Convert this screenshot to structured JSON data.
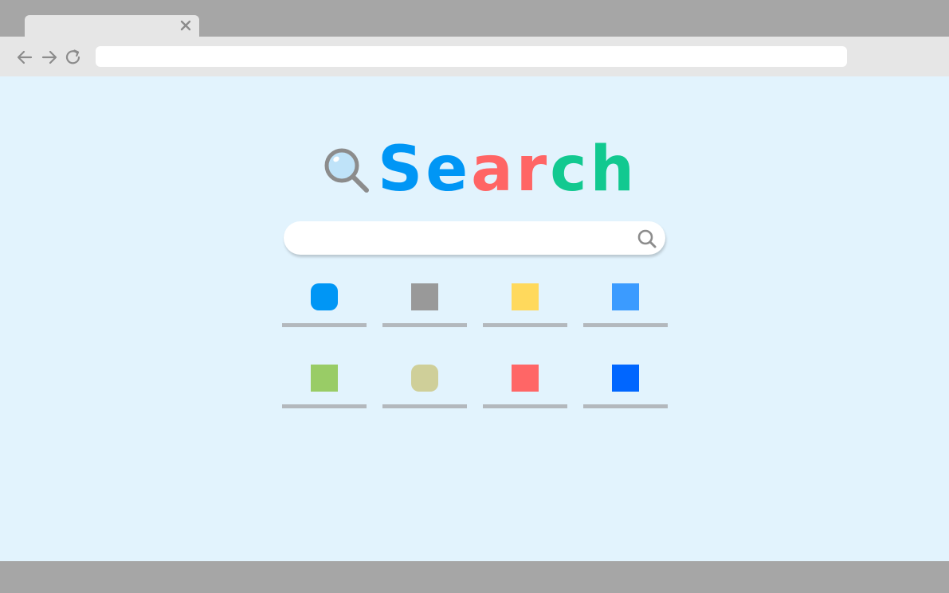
{
  "browser": {
    "tab": {
      "close_icon": "close-icon"
    },
    "toolbar": {
      "back_icon": "arrow-left-icon",
      "forward_icon": "arrow-right-icon",
      "reload_icon": "reload-icon",
      "address_value": ""
    }
  },
  "page": {
    "logo": {
      "icon": "magnifier-icon",
      "letters": [
        {
          "char": "S",
          "color": "#0096f5"
        },
        {
          "char": "e",
          "color": "#0096f5"
        },
        {
          "char": "a",
          "color": "#ff6565"
        },
        {
          "char": "r",
          "color": "#ff6565"
        },
        {
          "char": "c",
          "color": "#12c990"
        },
        {
          "char": "h",
          "color": "#12c990"
        }
      ]
    },
    "search": {
      "value": "",
      "icon": "search-icon"
    },
    "shortcuts": [
      {
        "color": "#0096f5",
        "shape": "rounded"
      },
      {
        "color": "#999999",
        "shape": "square"
      },
      {
        "color": "#ffd95c",
        "shape": "square"
      },
      {
        "color": "#3b9bff",
        "shape": "square"
      },
      {
        "color": "#99cc66",
        "shape": "square"
      },
      {
        "color": "#cfcf99",
        "shape": "rounded"
      },
      {
        "color": "#ff6666",
        "shape": "square"
      },
      {
        "color": "#0066ff",
        "shape": "square"
      }
    ]
  },
  "colors": {
    "chrome": "#a6a6a6",
    "toolbar": "#e6e6e6",
    "page_bg": "#e2f3fd",
    "icon_gray": "#8c8c8c"
  }
}
